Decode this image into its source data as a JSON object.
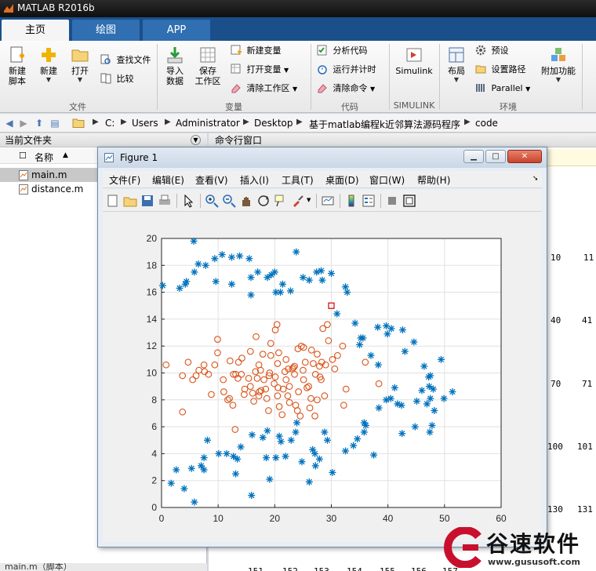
{
  "app": {
    "title": "MATLAB R2016b",
    "icon": "matlab-icon"
  },
  "tabs": [
    {
      "label": "主页",
      "active": true
    },
    {
      "label": "绘图",
      "active": false
    },
    {
      "label": "APP",
      "active": false
    }
  ],
  "ribbon": {
    "file_group": {
      "label": "文件",
      "new_script": "新建\n脚本",
      "new": "新建",
      "open": "打开",
      "find_files": "查找文件",
      "compare": "比较"
    },
    "variable_group": {
      "label": "变量",
      "import_data": "导入\n数据",
      "save_workspace": "保存\n工作区",
      "new_variable": "新建变量",
      "open_variable": "打开变量",
      "clear_workspace": "清除工作区"
    },
    "code_group": {
      "label": "代码",
      "analyze_code": "分析代码",
      "run_and_time": "运行并计时",
      "clear_commands": "清除命令"
    },
    "simulink_group": {
      "label": "SIMULINK",
      "simulink": "Simulink"
    },
    "environment_group": {
      "label": "环境",
      "layout": "布局",
      "preferences": "预设",
      "set_path": "设置路径",
      "parallel": "Parallel",
      "addons": "附加功能"
    }
  },
  "address_bar": {
    "path": [
      "C:",
      "Users",
      "Administrator",
      "Desktop",
      "基于matlab编程k近邻算法源码程序",
      "code"
    ]
  },
  "current_folder": {
    "title": "当前文件夹",
    "column_name": "名称",
    "sort_indicator": "▲",
    "files": [
      {
        "name": "main.m",
        "selected": true
      },
      {
        "name": "distance.m",
        "selected": false
      }
    ],
    "status": "main.m（脚本）"
  },
  "command_window": {
    "title": "命令行窗口",
    "numbers": [
      "10",
      "11",
      "40",
      "41",
      "70",
      "71",
      "100",
      "101",
      "130",
      "131",
      "151",
      "152",
      "153",
      "154",
      "155",
      "156",
      "157"
    ]
  },
  "figure": {
    "title": "Figure 1",
    "menus": [
      "文件(F)",
      "编辑(E)",
      "查看(V)",
      "插入(I)",
      "工具(T)",
      "桌面(D)",
      "窗口(W)",
      "帮助(H)"
    ],
    "toolbar_icons": [
      "new-figure-icon",
      "open-icon",
      "save-icon",
      "print-icon",
      "select-icon",
      "zoom-in-icon",
      "zoom-out-icon",
      "pan-icon",
      "rotate-icon",
      "data-cursor-icon",
      "brush-icon",
      "link-icon",
      "colorbar-icon",
      "legend-icon",
      "hide-tools-icon",
      "show-tools-icon"
    ]
  },
  "chart_data": {
    "type": "scatter",
    "title": "",
    "xlabel": "",
    "ylabel": "",
    "xlim": [
      0,
      60
    ],
    "ylim": [
      0,
      20
    ],
    "xticks": [
      0,
      10,
      20,
      30,
      40,
      50,
      60
    ],
    "yticks": [
      0,
      2,
      4,
      6,
      8,
      10,
      12,
      14,
      16,
      18,
      20
    ],
    "grid": true,
    "series": [
      {
        "marker": "asterisk",
        "color": "#0072BD",
        "points": [
          [
            5.7,
            19.8
          ],
          [
            0.2,
            16.5
          ],
          [
            3.2,
            16.3
          ],
          [
            4.4,
            16.8
          ],
          [
            4.2,
            16.6
          ],
          [
            5.8,
            17.5
          ],
          [
            6.5,
            18.1
          ],
          [
            7.8,
            18.0
          ],
          [
            9.4,
            18.5
          ],
          [
            10.7,
            18.8
          ],
          [
            12.4,
            18.6
          ],
          [
            13.8,
            18.7
          ],
          [
            15.5,
            18.5
          ],
          [
            9.6,
            16.8
          ],
          [
            12.4,
            16.6
          ],
          [
            15.8,
            17.1
          ],
          [
            15.8,
            15.8
          ],
          [
            17.0,
            17.5
          ],
          [
            18.7,
            17.1
          ],
          [
            19.4,
            17.3
          ],
          [
            20.0,
            17.5
          ],
          [
            20.2,
            16.0
          ],
          [
            21.0,
            16.0
          ],
          [
            21.4,
            16.6
          ],
          [
            22.8,
            16.1
          ],
          [
            23.8,
            19.0
          ],
          [
            25.0,
            17.1
          ],
          [
            26.1,
            16.9
          ],
          [
            27.4,
            17.5
          ],
          [
            28.2,
            17.6
          ],
          [
            28.4,
            16.9
          ],
          [
            30.0,
            17.4
          ],
          [
            32.5,
            16.4
          ],
          [
            32.8,
            16.0
          ],
          [
            31.0,
            14.4
          ],
          [
            34.2,
            13.7
          ],
          [
            35.2,
            12.6
          ],
          [
            35.6,
            12.6
          ],
          [
            35.0,
            12.1
          ],
          [
            37.0,
            11.3
          ],
          [
            39.7,
            13.5
          ],
          [
            38.2,
            13.4
          ],
          [
            38.3,
            10.6
          ],
          [
            39.9,
            12.9
          ],
          [
            40.6,
            13.3
          ],
          [
            43.0,
            11.6
          ],
          [
            42.6,
            13.2
          ],
          [
            44.6,
            12.3
          ],
          [
            46.4,
            10.5
          ],
          [
            49.4,
            11.0
          ],
          [
            47.5,
            9.8
          ],
          [
            47.2,
            9.7
          ],
          [
            46.0,
            8.7
          ],
          [
            47.3,
            9.0
          ],
          [
            48.0,
            8.8
          ],
          [
            51.4,
            8.6
          ],
          [
            49.9,
            8.1
          ],
          [
            47.5,
            8.1
          ],
          [
            48.2,
            7.2
          ],
          [
            45.1,
            7.9
          ],
          [
            46.9,
            7.7
          ],
          [
            41.2,
            8.9
          ],
          [
            39.7,
            8.0
          ],
          [
            40.5,
            8.1
          ],
          [
            41.7,
            7.7
          ],
          [
            42.4,
            7.6
          ],
          [
            38.4,
            7.4
          ],
          [
            44.8,
            6.0
          ],
          [
            47.8,
            6.1
          ],
          [
            47.4,
            5.6
          ],
          [
            42.5,
            5.5
          ],
          [
            36.1,
            6.1
          ],
          [
            35.8,
            5.6
          ],
          [
            34.6,
            5.1
          ],
          [
            35.8,
            6.3
          ],
          [
            33.9,
            4.6
          ],
          [
            32.5,
            4.2
          ],
          [
            37.5,
            3.9
          ],
          [
            29.3,
            5.0
          ],
          [
            28.8,
            5.6
          ],
          [
            27.1,
            4.0
          ],
          [
            27.9,
            3.6
          ],
          [
            27.2,
            3.1
          ],
          [
            26.7,
            4.3
          ],
          [
            24.8,
            3.4
          ],
          [
            23.7,
            5.6
          ],
          [
            23.9,
            6.3
          ],
          [
            22.9,
            5.0
          ],
          [
            21.9,
            3.8
          ],
          [
            20.8,
            5.3
          ],
          [
            21.1,
            4.9
          ],
          [
            20.2,
            3.7
          ],
          [
            18.7,
            5.7
          ],
          [
            17.9,
            5.2
          ],
          [
            16.0,
            5.4
          ],
          [
            18.5,
            3.7
          ],
          [
            19.1,
            2.1
          ],
          [
            14.0,
            4.5
          ],
          [
            13.4,
            3.6
          ],
          [
            12.7,
            3.8
          ],
          [
            11.5,
            4.0
          ],
          [
            10.1,
            4.0
          ],
          [
            13.1,
            2.5
          ],
          [
            8.1,
            5.0
          ],
          [
            7.5,
            3.7
          ],
          [
            7.0,
            3.1
          ],
          [
            7.5,
            2.8
          ],
          [
            5.3,
            2.9
          ],
          [
            2.6,
            2.8
          ],
          [
            4.0,
            1.4
          ],
          [
            1.7,
            1.8
          ],
          [
            5.8,
            0.4
          ],
          [
            15.9,
            0.9
          ],
          [
            26.1,
            1.9
          ],
          [
            30.2,
            2.6
          ]
        ]
      },
      {
        "marker": "circle",
        "color": "#D95319",
        "points": [
          [
            0.8,
            10.6
          ],
          [
            3.7,
            9.8
          ],
          [
            3.7,
            7.1
          ],
          [
            4.7,
            10.8
          ],
          [
            5.5,
            9.5
          ],
          [
            6.1,
            9.8
          ],
          [
            6.6,
            10.2
          ],
          [
            7.5,
            10.6
          ],
          [
            7.6,
            10.1
          ],
          [
            8.3,
            9.9
          ],
          [
            8.8,
            8.4
          ],
          [
            9.4,
            10.6
          ],
          [
            9.9,
            11.5
          ],
          [
            9.9,
            12.5
          ],
          [
            10.9,
            9.5
          ],
          [
            11.0,
            8.6
          ],
          [
            11.7,
            8.0
          ],
          [
            12.0,
            8.1
          ],
          [
            12.1,
            10.9
          ],
          [
            12.7,
            9.9
          ],
          [
            13.1,
            9.9
          ],
          [
            13.5,
            9.6
          ],
          [
            12.6,
            7.6
          ],
          [
            13.6,
            10.8
          ],
          [
            13.0,
            5.8
          ],
          [
            14.2,
            11.1
          ],
          [
            14.7,
            8.8
          ],
          [
            14.6,
            8.4
          ],
          [
            15.4,
            9.6
          ],
          [
            15.7,
            11.6
          ],
          [
            16.1,
            8.5
          ],
          [
            16.3,
            7.9
          ],
          [
            16.6,
            10.1
          ],
          [
            16.7,
            12.7
          ],
          [
            16.9,
            9.6
          ],
          [
            17.3,
            8.6
          ],
          [
            17.2,
            8.3
          ],
          [
            17.5,
            10.2
          ],
          [
            17.2,
            10.6
          ],
          [
            17.9,
            11.4
          ],
          [
            17.6,
            8.7
          ],
          [
            18.1,
            9.5
          ],
          [
            18.4,
            8.8
          ],
          [
            18.6,
            8.1
          ],
          [
            18.9,
            7.2
          ],
          [
            19.1,
            10.0
          ],
          [
            19.3,
            11.3
          ],
          [
            19.3,
            12.2
          ],
          [
            19.9,
            9.2
          ],
          [
            20.1,
            9.7
          ],
          [
            20.5,
            8.3
          ],
          [
            20.1,
            13.2
          ],
          [
            20.4,
            13.6
          ],
          [
            20.7,
            11.5
          ],
          [
            20.5,
            10.7
          ],
          [
            20.8,
            7.5
          ],
          [
            21.3,
            6.9
          ],
          [
            21.5,
            8.8
          ],
          [
            22.0,
            11.0
          ],
          [
            22.0,
            9.5
          ],
          [
            22.6,
            9.0
          ],
          [
            22.4,
            10.3
          ],
          [
            23.1,
            10.3
          ],
          [
            23.3,
            10.4
          ],
          [
            23.5,
            9.9
          ],
          [
            23.7,
            7.6
          ],
          [
            24.0,
            7.2
          ],
          [
            24.2,
            8.6
          ],
          [
            24.5,
            6.8
          ],
          [
            24.1,
            11.8
          ],
          [
            24.7,
            12.0
          ],
          [
            25.1,
            9.5
          ],
          [
            25.4,
            10.8
          ],
          [
            25.1,
            11.9
          ],
          [
            25.7,
            8.9
          ],
          [
            26.2,
            7.4
          ],
          [
            26.4,
            8.1
          ],
          [
            26.5,
            11.7
          ],
          [
            26.8,
            10.7
          ],
          [
            27.2,
            9.9
          ],
          [
            27.1,
            6.8
          ],
          [
            27.5,
            11.4
          ],
          [
            27.9,
            10.5
          ],
          [
            28.3,
            10.8
          ],
          [
            28.2,
            9.5
          ],
          [
            28.8,
            8.3
          ],
          [
            29.0,
            10.6
          ],
          [
            28.5,
            13.3
          ],
          [
            29.3,
            13.6
          ],
          [
            29.5,
            12.4
          ],
          [
            30.2,
            11.0
          ],
          [
            30.6,
            10.3
          ],
          [
            31.1,
            11.3
          ],
          [
            32.0,
            12.0
          ],
          [
            32.6,
            8.8
          ],
          [
            32.2,
            7.6
          ],
          [
            36.0,
            10.8
          ],
          [
            38.4,
            9.2
          ],
          [
            22.3,
            8.3
          ],
          [
            23.5,
            10.5
          ],
          [
            19.0,
            9.8
          ],
          [
            15.7,
            9.0
          ],
          [
            14.1,
            9.9
          ],
          [
            26.0,
            9.0
          ],
          [
            27.5,
            8.0
          ],
          [
            28.0,
            9.7
          ],
          [
            25.0,
            10.2
          ],
          [
            21.8,
            10.1
          ],
          [
            20.6,
            8.9
          ],
          [
            22.6,
            7.8
          ]
        ]
      },
      {
        "marker": "square",
        "color": "#D00000",
        "points": [
          [
            30.0,
            15.0
          ]
        ]
      }
    ]
  },
  "logo": {
    "text": "谷速软件",
    "url": "www.gususoft.com"
  }
}
